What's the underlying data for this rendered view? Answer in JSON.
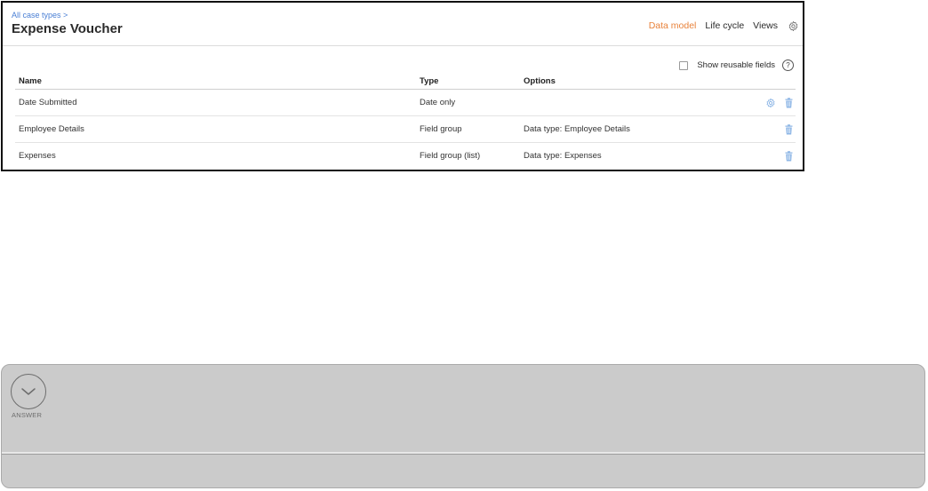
{
  "header": {
    "breadcrumb": "All case types >",
    "title": "Expense Voucher",
    "tabs": [
      {
        "label": "Data model",
        "active": true
      },
      {
        "label": "Life cycle",
        "active": false
      },
      {
        "label": "Views",
        "active": false
      }
    ]
  },
  "reusable": {
    "label": "Show reusable fields",
    "checked": false
  },
  "table": {
    "columns": [
      "Name",
      "Type",
      "Options"
    ],
    "rows": [
      {
        "name": "Date Submitted",
        "type": "Date only",
        "options": ""
      },
      {
        "name": "Employee Details",
        "type": "Field group",
        "options": "Data type:  Employee Details"
      },
      {
        "name": "Expenses",
        "type": "Field group (list)",
        "options": "Data type:  Expenses"
      }
    ]
  },
  "answer": {
    "label": "ANSWER"
  },
  "colors": {
    "accent": "#e8823a",
    "link": "#4a7fd4",
    "icon_blue": "#8fb7e6",
    "panel_gray": "#cbcbcb"
  },
  "icons": {
    "settings": "gear-icon",
    "help": "help-circle-icon",
    "delete": "trash-icon",
    "expand": "chevron-down-circle-icon"
  }
}
